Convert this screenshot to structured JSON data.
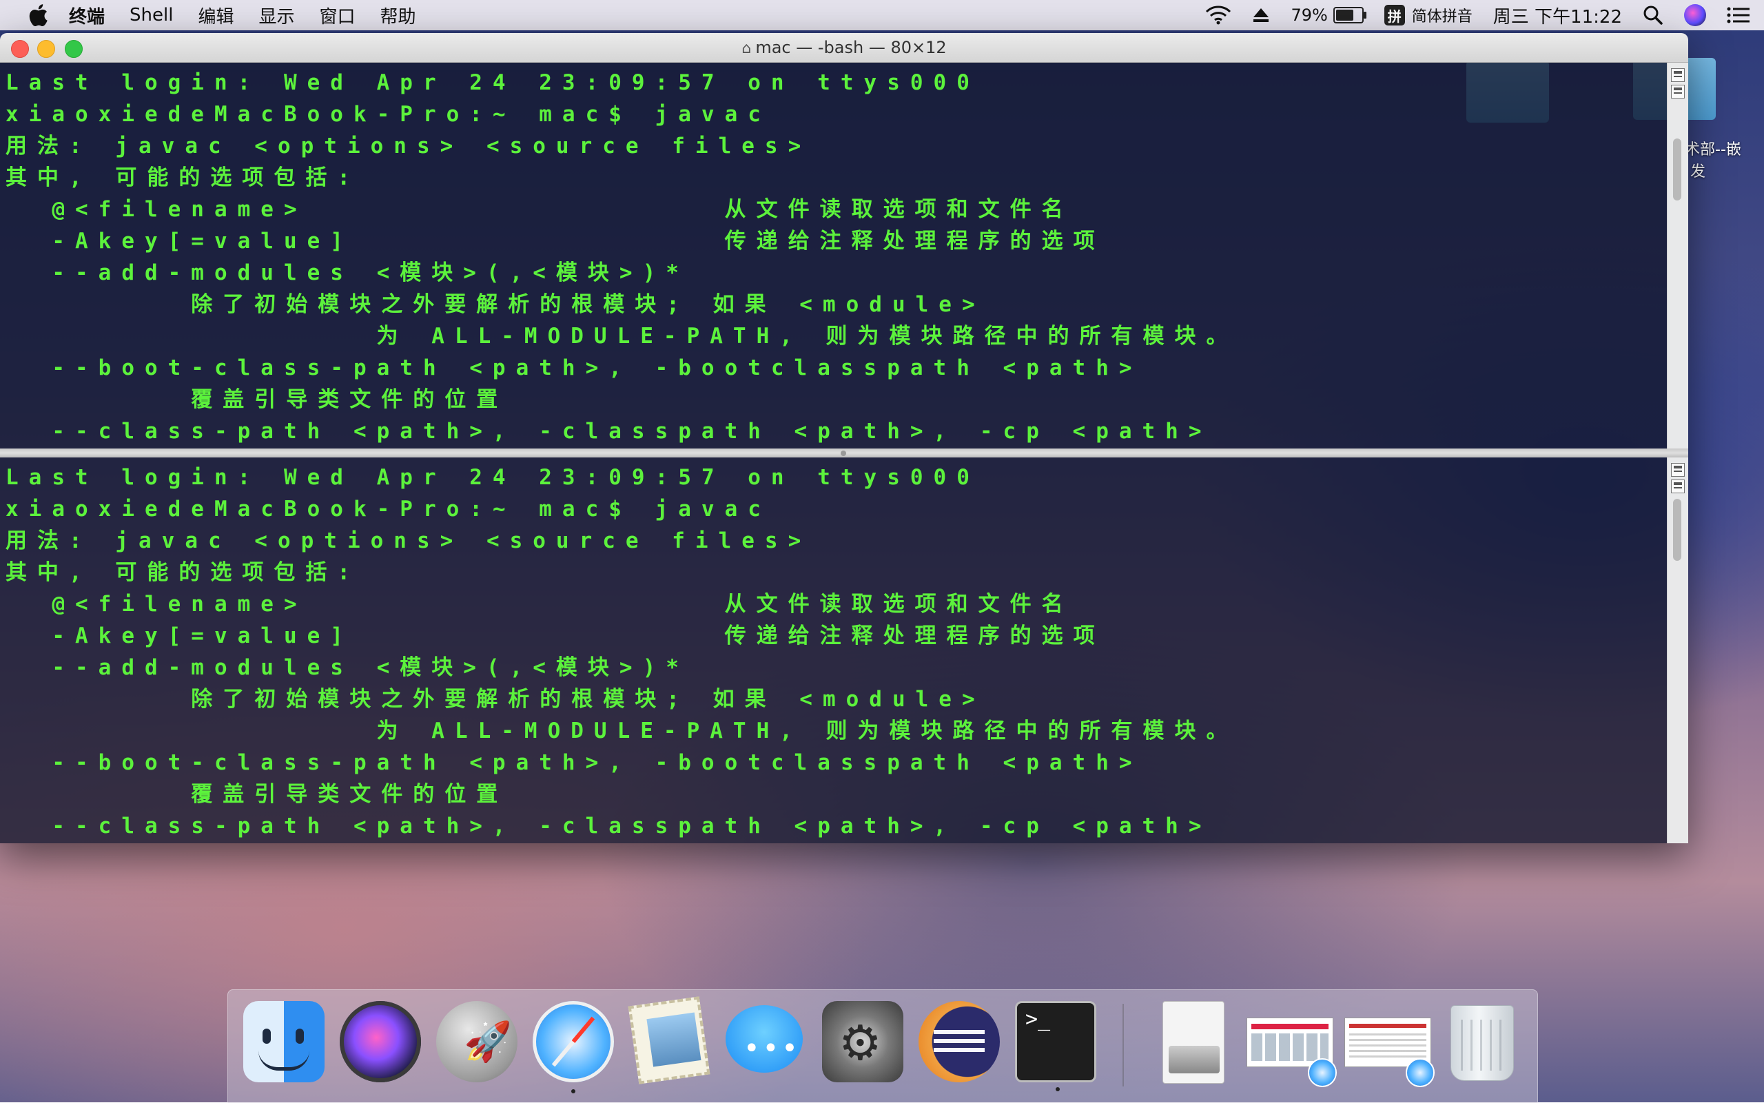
{
  "menubar": {
    "app_name": "终端",
    "items": [
      "Shell",
      "编辑",
      "显示",
      "窗口",
      "帮助"
    ],
    "battery_percent": "79%",
    "battery_level": 0.79,
    "ime_badge": "拼",
    "ime_name": "简体拼音",
    "clock": "周三 下午11:22"
  },
  "desktop": {
    "folder_label_line1": "术部--嵌",
    "folder_label_line2": "发"
  },
  "window": {
    "title": "mac — -bash — 80×12"
  },
  "terminal": {
    "lines": [
      "Last login: Wed Apr 24 23:09:57 on ttys000",
      "xiaoxiedeMacBook-Pro:~ mac$ javac",
      "用法: javac <options> <source files>",
      "其中, 可能的选项包括:",
      "  @<filename>                  从文件读取选项和文件名",
      "  -Akey[=value]                传递给注释处理程序的选项",
      "  --add-modules <模块>(,<模块>)*",
      "        除了初始模块之外要解析的根模块; 如果 <module>",
      "                为 ALL-MODULE-PATH, 则为模块路径中的所有模块。",
      "  --boot-class-path <path>, -bootclasspath <path>",
      "        覆盖引导类文件的位置",
      "  --class-path <path>, -classpath <path>, -cp <path>"
    ],
    "text_color": "#5cf23c"
  },
  "dock": {
    "apps": [
      {
        "name": "Finder",
        "icon": "finder-icon",
        "running": true
      },
      {
        "name": "Siri",
        "icon": "siri-icon",
        "running": false
      },
      {
        "name": "Launchpad",
        "icon": "launchpad-icon",
        "running": false
      },
      {
        "name": "Safari",
        "icon": "safari-icon",
        "running": true
      },
      {
        "name": "Mail",
        "icon": "mail-icon",
        "running": false
      },
      {
        "name": "Messages",
        "icon": "messages-icon",
        "running": false
      },
      {
        "name": "System Preferences",
        "icon": "system-preferences-icon",
        "running": false
      },
      {
        "name": "Eclipse",
        "icon": "eclipse-icon",
        "running": false
      },
      {
        "name": "Terminal",
        "icon": "terminal-icon",
        "running": true
      },
      {
        "name": "Downloads",
        "icon": "document-stack-icon",
        "running": false
      },
      {
        "name": "Safari window 1",
        "icon": "safari-window-thumbnail-icon",
        "running": false
      },
      {
        "name": "Safari window 2",
        "icon": "safari-window-thumbnail-icon",
        "running": false
      },
      {
        "name": "Trash",
        "icon": "trash-icon",
        "running": false
      }
    ],
    "terminal_prompt_glyph": ">_"
  }
}
